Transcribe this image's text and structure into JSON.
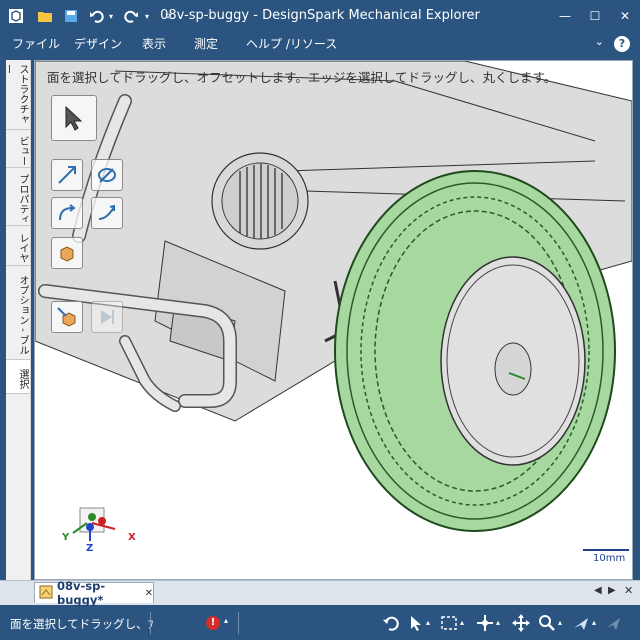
{
  "window": {
    "title": "08v-sp-buggy - DesignSpark Mechanical Explorer",
    "minimize_symbol": "—",
    "maximize_symbol": "☐",
    "close_symbol": "✕"
  },
  "quick_access": [
    "app-logo-icon",
    "folder-open-icon",
    "save-icon",
    "undo-icon",
    "redo-icon",
    "customize-icon"
  ],
  "menu": {
    "items": [
      "ファイル",
      "デザイン",
      "表示",
      "測定",
      "ヘルプ /リソース"
    ],
    "help_symbol": "?"
  },
  "side_tabs": [
    "ストラクチャー",
    "ビュー",
    "プロパティ",
    "レイヤ",
    "オプション - ブル",
    "選択"
  ],
  "viewport": {
    "hint": "面を選択してドラッグし、オフセットします。エッジを選択してドラッグし、丸くします。",
    "scale_label": "10mm",
    "triad": {
      "x": "X",
      "y": "Y",
      "z": "Z"
    },
    "tools": [
      "select-arrow-icon",
      "move-icon",
      "pull-icon",
      "revolve-icon",
      "sweep-icon",
      "blend-icon",
      "pull-solid-icon",
      "fill-icon"
    ],
    "colors": {
      "tire": "#a6d8a0",
      "body": "#dcdcdc"
    }
  },
  "document_tab": {
    "label": "08v-sp-buggy*",
    "close_symbol": "✕"
  },
  "status": {
    "text": "面を選択してドラッグし、ﾌ",
    "icons": [
      "error-icon",
      "rotate-icon",
      "select-icon",
      "box-select-icon",
      "pan-icon",
      "move-icon",
      "zoom-icon",
      "fly-icon",
      "snap-icon"
    ]
  }
}
